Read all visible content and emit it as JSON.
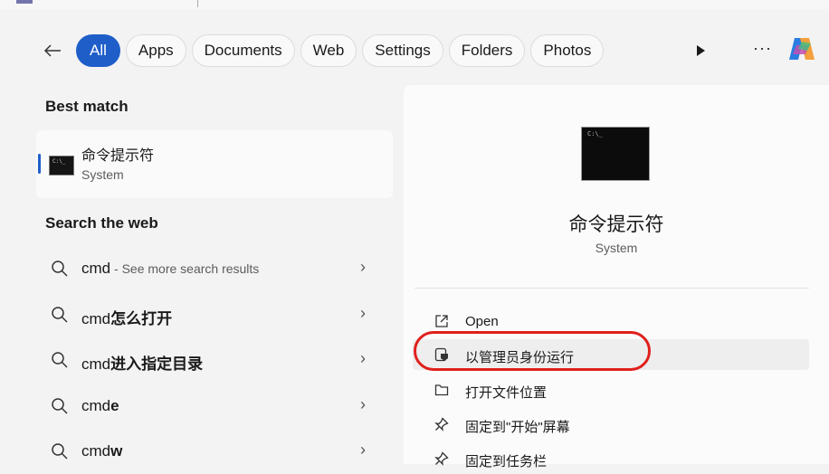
{
  "filters": {
    "items": [
      "All",
      "Apps",
      "Documents",
      "Web",
      "Settings",
      "Folders",
      "Photos"
    ],
    "active": "All",
    "accent": "#1f5ec9"
  },
  "left": {
    "best_match_heading": "Best match",
    "best_match": {
      "title": "命令提示符",
      "subtitle": "System",
      "icon": "command-prompt-icon"
    },
    "web_heading": "Search the web",
    "web_results": [
      {
        "prefix": "cmd",
        "suffix": "",
        "hint": " - See more search results"
      },
      {
        "prefix": "cmd",
        "suffix": "怎么打开",
        "hint": ""
      },
      {
        "prefix": "cmd",
        "suffix": "进入指定目录",
        "hint": ""
      },
      {
        "prefix": "cmd",
        "suffix": "e",
        "hint": ""
      },
      {
        "prefix": "cmd",
        "suffix": "w",
        "hint": ""
      }
    ]
  },
  "right": {
    "title": "命令提示符",
    "subtitle": "System",
    "actions": [
      {
        "label": "Open",
        "icon": "open-external-icon"
      },
      {
        "label": "以管理员身份运行",
        "icon": "run-as-admin-icon"
      },
      {
        "label": "打开文件位置",
        "icon": "folder-icon"
      },
      {
        "label": "固定到\"开始\"屏幕",
        "icon": "pin-icon"
      },
      {
        "label": "固定到任务栏",
        "icon": "pin-icon"
      }
    ],
    "highlight_color": "#e0201c"
  }
}
